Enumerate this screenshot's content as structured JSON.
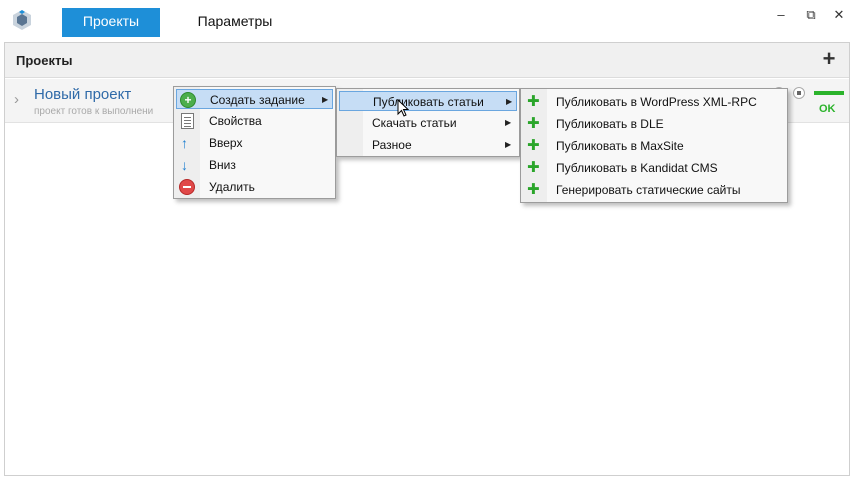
{
  "titlebar": {
    "tabs": [
      {
        "label": "Проекты",
        "active": true
      },
      {
        "label": "Параметры",
        "active": false
      }
    ],
    "window_controls": {
      "minimize": "–",
      "maximize": "⧉",
      "close": "✕"
    }
  },
  "panel": {
    "title": "Проекты",
    "add_icon": "+"
  },
  "project": {
    "name": "Новый проект",
    "subtitle": "проект готов к выполнени",
    "status": "OK",
    "status_color": "#2bb32b"
  },
  "menu_main": {
    "items": [
      {
        "label": "Создать задание",
        "icon": "add-icon",
        "submenu": true,
        "highlighted": true
      },
      {
        "label": "Свойства",
        "icon": "properties-icon"
      },
      {
        "label": "Вверх",
        "icon": "arrow-up-icon"
      },
      {
        "label": "Вниз",
        "icon": "arrow-down-icon"
      },
      {
        "label": "Удалить",
        "icon": "delete-icon"
      }
    ]
  },
  "menu_create": {
    "items": [
      {
        "label": "Публиковать статьи",
        "submenu": true,
        "highlighted": true
      },
      {
        "label": "Скачать статьи",
        "submenu": true
      },
      {
        "label": "Разное",
        "submenu": true
      }
    ]
  },
  "menu_publish": {
    "items": [
      {
        "label": "Публиковать в WordPress XML-RPC",
        "icon": "puzzle-icon"
      },
      {
        "label": "Публиковать в DLE",
        "icon": "puzzle-icon"
      },
      {
        "label": "Публиковать в MaxSite",
        "icon": "puzzle-icon"
      },
      {
        "label": "Публиковать в Kandidat CMS",
        "icon": "puzzle-icon"
      },
      {
        "label": "Генерировать статические сайты",
        "icon": "puzzle-icon"
      }
    ]
  },
  "colors": {
    "accent": "#1e8fd8",
    "menu_highlight": "#c6ddf5",
    "project_link": "#2f6aa8"
  }
}
